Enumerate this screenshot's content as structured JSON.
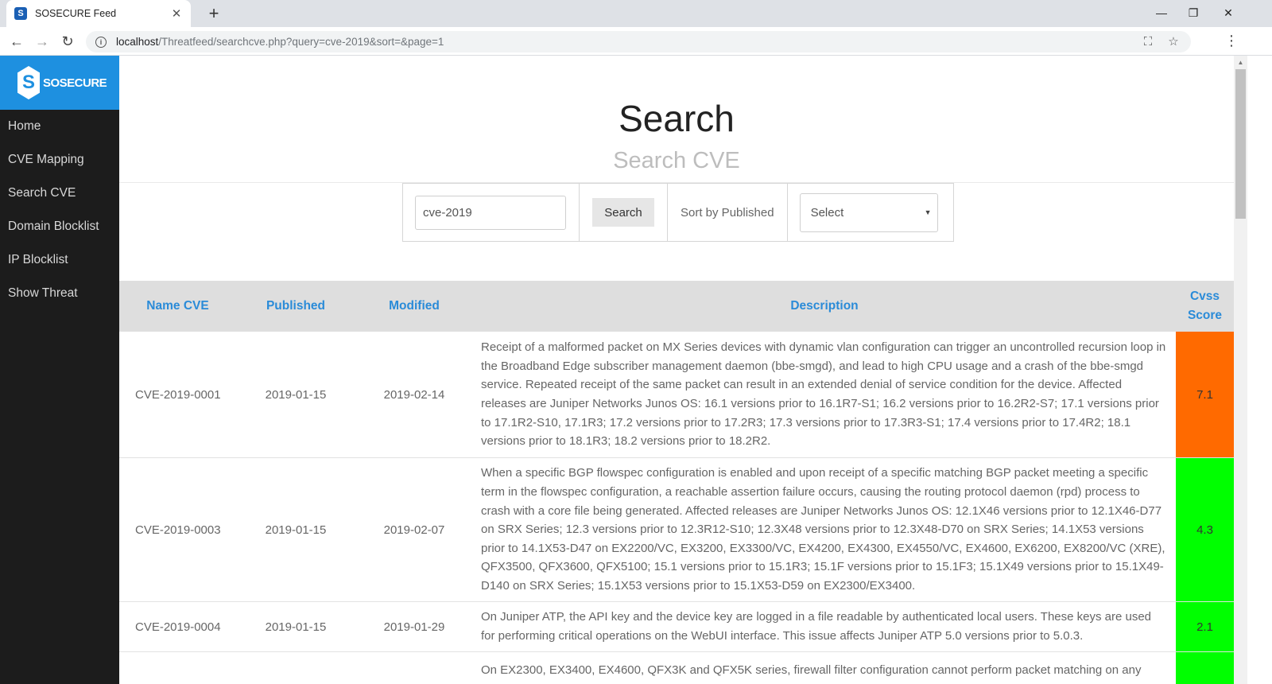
{
  "browser": {
    "tab_title": "SOSECURE Feed",
    "favicon_letter": "S",
    "url_host": "localhost",
    "url_path": "/Threatfeed/searchcve.php?query=cve-2019&sort=&page=1"
  },
  "sidebar": {
    "brand": "SOSECURE",
    "brand_mark": "S",
    "items": [
      {
        "label": "Home"
      },
      {
        "label": "CVE Mapping"
      },
      {
        "label": "Search CVE"
      },
      {
        "label": "Domain Blocklist"
      },
      {
        "label": "IP Blocklist"
      },
      {
        "label": "Show Threat"
      }
    ]
  },
  "header": {
    "title": "Search",
    "subtitle": "Search CVE"
  },
  "search": {
    "query_value": "cve-2019",
    "button_label": "Search",
    "sort_label": "Sort by Published",
    "select_value": "Select"
  },
  "table": {
    "columns": [
      "Name CVE",
      "Published",
      "Modified",
      "Description",
      "Cvss Score"
    ],
    "rows": [
      {
        "name": "CVE-2019-0001",
        "published": "2019-01-15",
        "modified": "2019-02-14",
        "description": "Receipt of a malformed packet on MX Series devices with dynamic vlan configuration can trigger an uncontrolled recursion loop in the Broadband Edge subscriber management daemon (bbe-smgd), and lead to high CPU usage and a crash of the bbe-smgd service. Repeated receipt of the same packet can result in an extended denial of service condition for the device. Affected releases are Juniper Networks Junos OS: 16.1 versions prior to 16.1R7-S1; 16.2 versions prior to 16.2R2-S7; 17.1 versions prior to 17.1R2-S10, 17.1R3; 17.2 versions prior to 17.2R3; 17.3 versions prior to 17.3R3-S1; 17.4 versions prior to 17.4R2; 18.1 versions prior to 18.1R3; 18.2 versions prior to 18.2R2.",
        "score": "7.1",
        "score_color": "#ff6a00"
      },
      {
        "name": "CVE-2019-0003",
        "published": "2019-01-15",
        "modified": "2019-02-07",
        "description": "When a specific BGP flowspec configuration is enabled and upon receipt of a specific matching BGP packet meeting a specific term in the flowspec configuration, a reachable assertion failure occurs, causing the routing protocol daemon (rpd) process to crash with a core file being generated. Affected releases are Juniper Networks Junos OS: 12.1X46 versions prior to 12.1X46-D77 on SRX Series; 12.3 versions prior to 12.3R12-S10; 12.3X48 versions prior to 12.3X48-D70 on SRX Series; 14.1X53 versions prior to 14.1X53-D47 on EX2200/VC, EX3200, EX3300/VC, EX4200, EX4300, EX4550/VC, EX4600, EX6200, EX8200/VC (XRE), QFX3500, QFX3600, QFX5100; 15.1 versions prior to 15.1R3; 15.1F versions prior to 15.1F3; 15.1X49 versions prior to 15.1X49-D140 on SRX Series; 15.1X53 versions prior to 15.1X53-D59 on EX2300/EX3400.",
        "score": "4.3",
        "score_color": "#00ff00"
      },
      {
        "name": "CVE-2019-0004",
        "published": "2019-01-15",
        "modified": "2019-01-29",
        "description": "On Juniper ATP, the API key and the device key are logged in a file readable by authenticated local users. These keys are used for performing critical operations on the WebUI interface. This issue affects Juniper ATP 5.0 versions prior to 5.0.3.",
        "score": "2.1",
        "score_color": "#00ff00"
      },
      {
        "name": "",
        "published": "",
        "modified": "",
        "description": "On EX2300, EX3400, EX4600, QFX3K and QFX5K series, firewall filter configuration cannot perform packet matching on any",
        "score": "",
        "score_color": "#00ff00"
      }
    ]
  },
  "colors": {
    "brand_blue": "#1e90e0",
    "sidebar_bg": "#1c1c1c",
    "header_link": "#2a8bd8",
    "score_high": "#ff6a00",
    "score_low": "#00ff00"
  }
}
